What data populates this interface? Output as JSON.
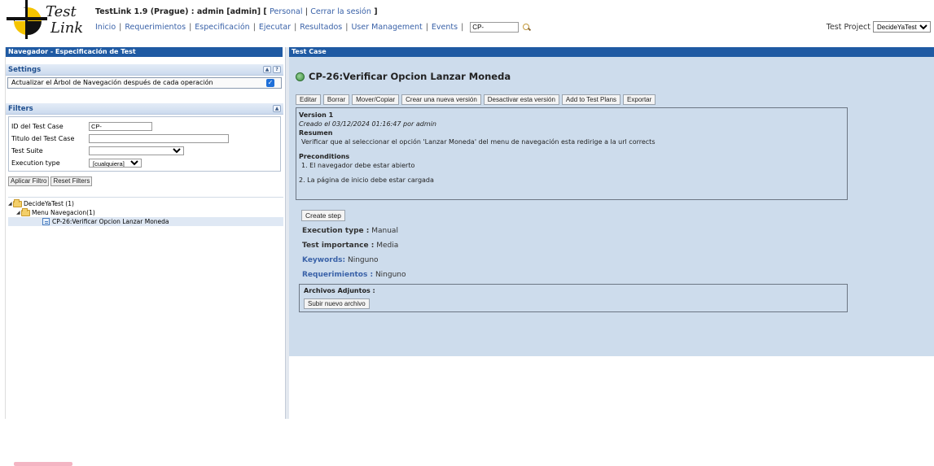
{
  "header": {
    "logo_word1": "Test",
    "logo_word2": "Link",
    "title_main": "TestLink 1.9 (Prague) : admin [admin] [",
    "personal_link": "Personal",
    "title_sep": "|",
    "logout_link": "Cerrar la sesión",
    "title_close": "]",
    "nav": [
      "Inicio",
      "Requerimientos",
      "Especificación",
      "Ejecutar",
      "Resultados",
      "User Management",
      "Events"
    ],
    "search_value": "CP-",
    "project_label": "Test Project",
    "project_value": "DecideYaTest"
  },
  "left_panel": {
    "title": "Navegador - Especificación de Test",
    "settings_title": "Settings",
    "settings_option": "Actualizar el Árbol de Navegación después de cada operación",
    "settings_checked": true,
    "filters_title": "Filters",
    "filters": {
      "tc_id_label": "ID del Test Case",
      "tc_id_value": "CP-",
      "title_label": "Titulo del Test Case",
      "title_value": "",
      "suite_label": "Test Suite",
      "suite_value": "",
      "exec_label": "Execution type",
      "exec_value": "[cualquiera]"
    },
    "apply_button": "Aplicar Filtro",
    "reset_button": "Reset Filters",
    "tree": [
      {
        "label": "DecideYaTest (1)",
        "level": 0,
        "type": "folder"
      },
      {
        "label": "Menu Navegacion(1)",
        "level": 1,
        "type": "folder"
      },
      {
        "label": "CP-26:Verificar Opcion Lanzar Moneda",
        "level": 2,
        "type": "testcase"
      }
    ]
  },
  "right_panel": {
    "title": "Test Case",
    "tc_heading": "CP-26:Verificar Opcion Lanzar Moneda",
    "actions": [
      "Editar",
      "Borrar",
      "Mover/Copiar",
      "Crear una nueva versión",
      "Desactivar esta versión",
      "Add to Test Plans",
      "Exportar"
    ],
    "version": {
      "label": "Version 1",
      "created": "Creado el 03/12/2024 01:16:47  por admin",
      "summary_label": "Resumen",
      "summary_text": "Verificar que al seleccionar el opción 'Lanzar Moneda' del menu de navegación esta redirige a la url corrects",
      "preconditions_label": "Preconditions",
      "precondition_1": "1. El navegador debe estar abierto",
      "precondition_2": "2. La página de inicio debe estar cargada"
    },
    "create_step_button": "Create step",
    "execution_type_label": "Execution type :",
    "execution_type_value": "Manual",
    "importance_label": "Test importance :",
    "importance_value": "Media",
    "keywords_label": "Keywords:",
    "keywords_value": "Ninguno",
    "requirements_label": "Requerimientos :",
    "requirements_value": "Ninguno",
    "attachments_label": "Archivos Adjuntos :",
    "upload_button": "Subir nuevo archivo"
  }
}
